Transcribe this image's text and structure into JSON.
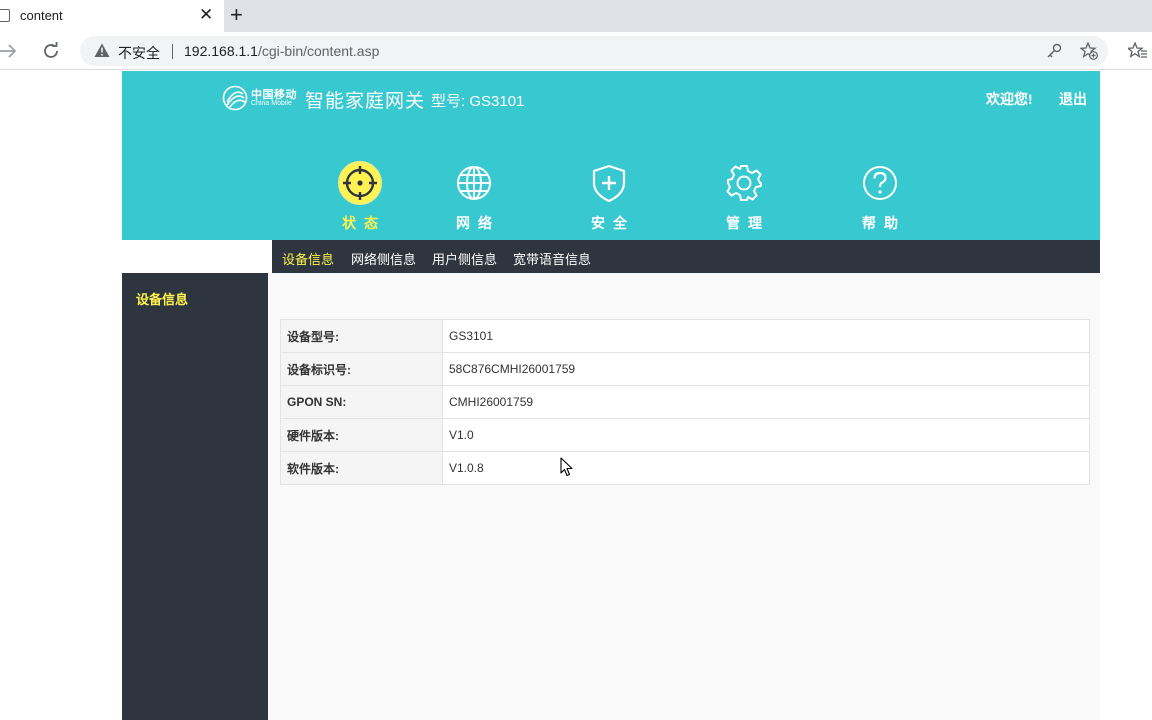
{
  "browser": {
    "tab_title": "content",
    "insecure_label": "不安全",
    "url_host": "192.168.1.1",
    "url_path": "/cgi-bin/content.asp"
  },
  "header": {
    "logo_cn": "中国移动",
    "logo_en": "China Mobile",
    "product_name": "智能家庭网关",
    "model_label": "型号: GS3101",
    "welcome": "欢迎您!",
    "logout": "退出"
  },
  "nav": [
    {
      "label": "状态",
      "icon": "target-icon",
      "active": true
    },
    {
      "label": "网络",
      "icon": "globe-icon",
      "active": false
    },
    {
      "label": "安全",
      "icon": "shield-icon",
      "active": false
    },
    {
      "label": "管理",
      "icon": "gear-icon",
      "active": false
    },
    {
      "label": "帮助",
      "icon": "help-icon",
      "active": false
    }
  ],
  "subnav": [
    {
      "label": "设备信息",
      "active": true
    },
    {
      "label": "网络侧信息",
      "active": false
    },
    {
      "label": "用户侧信息",
      "active": false
    },
    {
      "label": "宽带语音信息",
      "active": false
    }
  ],
  "sidebar": {
    "items": [
      {
        "label": "设备信息"
      }
    ]
  },
  "device_info": {
    "rows": [
      {
        "label": "设备型号:",
        "value": "GS3101"
      },
      {
        "label": "设备标识号:",
        "value": "58C876CMHI26001759"
      },
      {
        "label": "GPON SN:",
        "value": "CMHI26001759"
      },
      {
        "label": "硬件版本:",
        "value": "V1.0"
      },
      {
        "label": "软件版本:",
        "value": "V1.0.8"
      }
    ]
  },
  "colors": {
    "header_bg": "#38c9d0",
    "dark_bg": "#2e353e",
    "active_yellow": "#fff44f"
  }
}
